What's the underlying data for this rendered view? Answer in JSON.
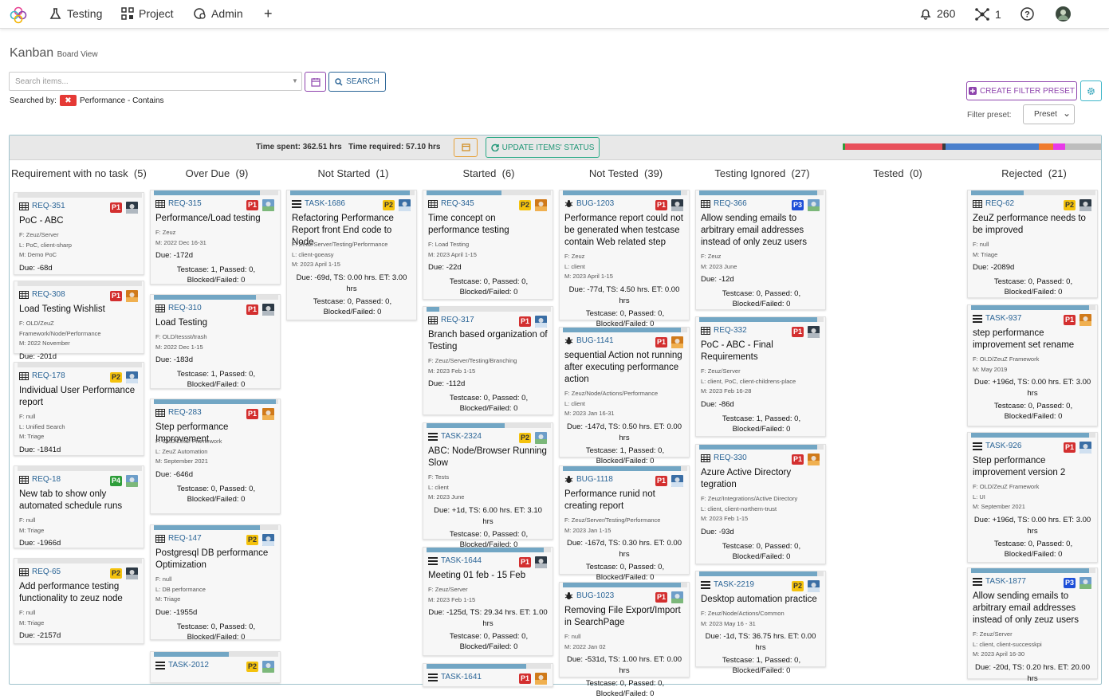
{
  "nav": {
    "testing": "Testing",
    "project": "Project",
    "admin": "Admin",
    "notif_count": "260",
    "network_count": "1"
  },
  "page": {
    "title": "Kanban",
    "subtitle": "Board View"
  },
  "search": {
    "placeholder": "Search items...",
    "button": "SEARCH",
    "searched_by_label": "Searched by:",
    "filter_text": "Performance - Contains"
  },
  "filters": {
    "create_preset": "CREATE FILTER PRESET",
    "preset_label": "Filter preset:",
    "preset_value": "Preset"
  },
  "toolbar": {
    "time_spent": "Time spent: 362.51 hrs",
    "time_required": "Time required: 57.10 hrs",
    "update_btn": "UPDATE ITEMS' STATUS",
    "progress_colors": [
      "#2e9e3a",
      "#e8505b",
      "#3a3a3a",
      "#4a7fcc",
      "#f07b2d",
      "#e83ae8",
      "#bdbdbd"
    ]
  },
  "columns": [
    {
      "name": "Requirement with no task",
      "count": "(5)"
    },
    {
      "name": "Over Due",
      "count": "(9)"
    },
    {
      "name": "Not Started",
      "count": "(1)"
    },
    {
      "name": "Started",
      "count": "(6)"
    },
    {
      "name": "Not Tested",
      "count": "(39)"
    },
    {
      "name": "Testing Ignored",
      "count": "(27)"
    },
    {
      "name": "Tested",
      "count": "(0)"
    },
    {
      "name": "Rejected",
      "count": "(21)"
    }
  ],
  "cards": {
    "c0": [
      {
        "id": "REQ-351",
        "pri": "P1",
        "title": "PoC - ABC",
        "meta": [
          "F: Zeuz/Server",
          "L: PoC, client-sharp",
          "M: Demo PoC"
        ],
        "due": "Due: -68d"
      },
      {
        "id": "REQ-308",
        "pri": "P1",
        "title": "Load Testing Wishlist",
        "meta": [
          "F: OLD/ZeuZ",
          "Framework/Node/Performance",
          "M: 2022 November"
        ],
        "due": "Due: -201d"
      },
      {
        "id": "REQ-178",
        "pri": "P2",
        "title": "Individual User Performance report",
        "meta": [
          "F: null",
          "L: Unified Search",
          "M: Triage"
        ],
        "due": "Due: -1841d"
      },
      {
        "id": "REQ-18",
        "pri": "P4",
        "title": "New tab to show only automated schedule runs",
        "meta": [
          "F: null",
          "M: Triage"
        ],
        "due": "Due: -1966d"
      },
      {
        "id": "REQ-65",
        "pri": "P2",
        "title": "Add performance testing functionality to zeuz node",
        "meta": [
          "F: null",
          "M: Triage"
        ],
        "due": "Due: -2157d"
      }
    ],
    "c1": [
      {
        "id": "REQ-315",
        "pri": "P1",
        "title": "Performance/Load testing",
        "meta": [
          "F: Zeuz",
          "M: 2022 Dec 16-31"
        ],
        "due": "Due: -172d",
        "tc": "Testcase: 1, Passed: 0, Blocked/Failed: 0"
      },
      {
        "id": "REQ-310",
        "pri": "P1",
        "title": "Load Testing",
        "meta": [
          "F: OLD/tessst/trash",
          "M: 2022 Dec 1-15"
        ],
        "due": "Due: -183d",
        "tc": "Testcase: 1, Passed: 0, Blocked/Failed: 0"
      },
      {
        "id": "REQ-283",
        "pri": "P1",
        "title": "Step performance Improvement",
        "meta": [
          "F: OLD/ZeuZ Framework",
          "L: ZeuZ Automation",
          "M: September 2021"
        ],
        "due": "Due: -646d",
        "tc": "Testcase: 0, Passed: 0, Blocked/Failed: 0"
      },
      {
        "id": "REQ-147",
        "pri": "P2",
        "title": "Postgresql DB performance Optimization",
        "meta": [
          "F: null",
          "L: DB performance",
          "M: Triage"
        ],
        "due": "Due: -1955d",
        "tc": "Testcase: 0, Passed: 0, Blocked/Failed: 0"
      },
      {
        "id": "TASK-2012",
        "pri": "P2"
      }
    ],
    "c2": [
      {
        "id": "TASK-1686",
        "pri": "P2",
        "title": "Refactoring Performance Report front End code to Node",
        "meta": [
          "F: Zeuz/Server/Testing/Performance",
          "L: client-goeasy",
          "M: 2023 April 1-15"
        ],
        "due": "Due: -69d, TS: 0.00 hrs. ET: 3.00 hrs",
        "tc": "Testcase: 0, Passed: 0, Blocked/Failed: 0"
      }
    ],
    "c3": [
      {
        "id": "REQ-345",
        "pri": "P2",
        "title": "Time concept on performance testing",
        "meta": [
          "F: Load Testing",
          "M: 2023 April 1-15"
        ],
        "due": "Due: -22d",
        "tc": "Testcase: 0, Passed: 0, Blocked/Failed: 0"
      },
      {
        "id": "REQ-317",
        "pri": "P1",
        "title": "Branch based organization of Testing",
        "meta": [
          "F: Zeuz/Server/Testing/Branching",
          "M: 2023 Feb 1-15"
        ],
        "due": "Due: -112d",
        "tc": "Testcase: 0, Passed: 0, Blocked/Failed: 0"
      },
      {
        "id": "TASK-2324",
        "pri": "P2",
        "title": "ABC: Node/Browser Running Slow",
        "meta": [
          "F: Tests",
          "L: client",
          "M: 2023 June"
        ],
        "due": "Due: +1d, TS: 6.00 hrs. ET: 3.10 hrs",
        "tc": "Testcase: 0, Passed: 0, Blocked/Failed: 0"
      },
      {
        "id": "TASK-1644",
        "pri": "P1",
        "title": "Meeting 01 feb - 15 Feb",
        "meta": [
          "F: Zeuz/Server",
          "M: 2023 Feb 1-15"
        ],
        "due": "Due: -125d, TS: 29.34 hrs. ET: 1.00 hrs",
        "tc": "Testcase: 0, Passed: 0, Blocked/Failed: 0"
      },
      {
        "id": "TASK-1641",
        "pri": "P1"
      }
    ],
    "c4": [
      {
        "id": "BUG-1203",
        "pri": "P1",
        "title": "Performance report could not be generated when testcase contain Web related step",
        "meta": [
          "F: Zeuz",
          "L: client",
          "M: 2023 April 1-15"
        ],
        "due": "Due: -77d, TS: 4.50 hrs. ET: 0.00 hrs",
        "tc": "Testcase: 0, Passed: 0, Blocked/Failed: 0"
      },
      {
        "id": "BUG-1141",
        "pri": "P1",
        "title": "sequential Action not running after executing performance action",
        "meta": [
          "F: Zeuz/Node/Actions/Performance",
          "L: client",
          "M: 2023 Jan 16-31"
        ],
        "due": "Due: -147d, TS: 0.50 hrs. ET: 0.00 hrs",
        "tc": "Testcase: 1, Passed: 0, Blocked/Failed: 0"
      },
      {
        "id": "BUG-1118",
        "pri": "P1",
        "title": "Performance runid not creating report",
        "meta": [
          "F: Zeuz/Server/Testing/Performance",
          "M: 2023 Jan 1-15"
        ],
        "due": "Due: -167d, TS: 0.30 hrs. ET: 0.00 hrs",
        "tc": "Testcase: 0, Passed: 0, Blocked/Failed: 0"
      },
      {
        "id": "BUG-1023",
        "pri": "P1",
        "title": "Removing File Export/Import in SearchPage",
        "meta": [
          "F: null",
          "M: 2022 Jan 02"
        ],
        "due": "Due: -531d, TS: 1.00 hrs. ET: 0.00 hrs",
        "tc": "Testcase: 0, Passed: 0, Blocked/Failed: 0"
      }
    ],
    "c5": [
      {
        "id": "REQ-366",
        "pri": "P3",
        "title": "Allow sending emails to arbitrary email addresses instead of only zeuz users",
        "meta": [
          "F: Zeuz",
          "M: 2023 June"
        ],
        "due": "Due: -12d",
        "tc": "Testcase: 0, Passed: 0, Blocked/Failed: 0"
      },
      {
        "id": "REQ-332",
        "pri": "P1",
        "title": "PoC - ABC - Final Requirements",
        "meta": [
          "F: Zeuz/Server",
          "L: client, PoC, client-childrens-place",
          "M: 2023 Feb 16-28"
        ],
        "due": "Due: -86d",
        "tc": "Testcase: 1, Passed: 0, Blocked/Failed: 0"
      },
      {
        "id": "REQ-330",
        "pri": "P1",
        "title": "Azure Active Directory tegration",
        "meta": [
          "F: Zeuz/Integrations/Active Directory",
          "L: client, client-northern-trust",
          "M: 2023 Feb 1-15"
        ],
        "due": "Due: -93d",
        "tc": "Testcase: 0, Passed: 0, Blocked/Failed: 0"
      },
      {
        "id": "TASK-2219",
        "pri": "P2",
        "title": "Desktop automation practice",
        "meta": [
          "F: Zeuz/Node/Actions/Common",
          "M: 2023 May 16 - 31"
        ],
        "due": "Due: -1d, TS: 36.75 hrs. ET: 0.00 hrs",
        "tc": "Testcase: 1, Passed: 0, Blocked/Failed: 0"
      }
    ],
    "c7": [
      {
        "id": "REQ-62",
        "pri": "P2",
        "title": "ZeuZ performance needs to be improved",
        "meta": [
          "F: null",
          "M: Triage"
        ],
        "due": "Due: -2089d",
        "tc": "Testcase: 0, Passed: 0, Blocked/Failed: 0"
      },
      {
        "id": "TASK-937",
        "pri": "P1",
        "title": "step performance improvement set rename",
        "meta": [
          "F: OLD/ZeuZ Framework",
          "M: May 2019"
        ],
        "due": "Due: +196d, TS: 0.00 hrs. ET: 3.00 hrs",
        "tc": "Testcase: 0, Passed: 0, Blocked/Failed: 0"
      },
      {
        "id": "TASK-926",
        "pri": "P1",
        "title": "Step performance improvement version 2",
        "meta": [
          "F: OLD/ZeuZ Framework",
          "L: UI",
          "M: September 2021"
        ],
        "due": "Due: +196d, TS: 0.00 hrs. ET: 3.00 hrs",
        "tc": "Testcase: 0, Passed: 0, Blocked/Failed: 0"
      },
      {
        "id": "TASK-1877",
        "pri": "P3",
        "title": "Allow sending emails to arbitrary email addresses instead of only zeuz users",
        "meta": [
          "F: Zeuz/Server",
          "L: client, client-successkpi",
          "M: 2023 April 16-30"
        ],
        "due": "Due: -20d, TS: 0.20 hrs. ET: 20.00 hrs"
      }
    ]
  }
}
